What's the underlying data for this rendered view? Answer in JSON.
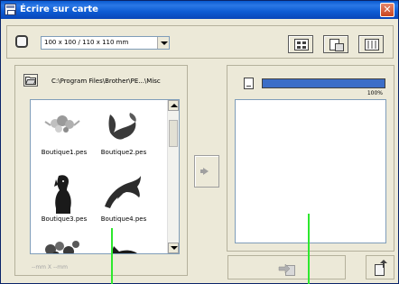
{
  "window": {
    "title": "Écrire sur carte"
  },
  "toolbar": {
    "hoop_select": {
      "value": "100 x 100 / 110 x 110 mm"
    },
    "buttons": [
      {
        "name": "grid-view-button",
        "icon": "grid-view-icon"
      },
      {
        "name": "card-view-button",
        "icon": "card-view-icon"
      },
      {
        "name": "list-view-button",
        "icon": "list-view-icon"
      }
    ]
  },
  "folder": {
    "path": "C:\\Program Files\\Brother\\PE...\\Misc"
  },
  "files": [
    {
      "name": "Boutique1.pes",
      "motif": "roses"
    },
    {
      "name": "Boutique2.pes",
      "motif": "bird"
    },
    {
      "name": "Boutique3.pes",
      "motif": "dog"
    },
    {
      "name": "Boutique4.pes",
      "motif": "dolphin"
    },
    {
      "name": "",
      "motif": "flowers-partial"
    },
    {
      "name": "",
      "motif": "cat-partial"
    }
  ],
  "size_label": "--mm X --mm",
  "card": {
    "progress_percent": 100,
    "progress_text": "100%"
  },
  "colors": {
    "accent": "#0a5ad0",
    "guide": "#2ee82e"
  }
}
